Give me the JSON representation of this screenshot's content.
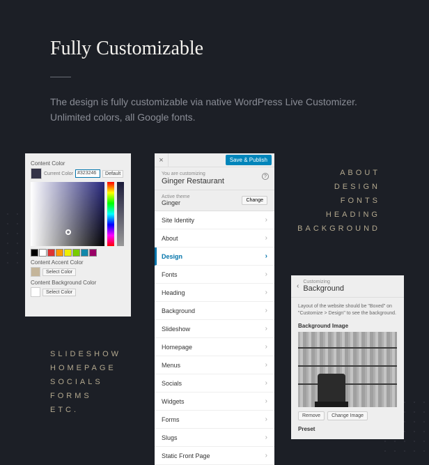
{
  "hero": {
    "title": "Fully Customizable",
    "description": "The design is fully customizable via native WordPress Live Customizer. Unlimited colors, all Google fonts."
  },
  "left_list": [
    "SLIDESHOW",
    "HOMEPAGE",
    "SOCIALS",
    "FORMS",
    "ETC."
  ],
  "right_list": [
    "ABOUT",
    "DESIGN",
    "FONTS",
    "HEADING",
    "BACKGROUND"
  ],
  "panel1": {
    "content_color_label": "Content Color",
    "current_color_label": "Current Color",
    "hex": "#323246",
    "default_btn": "Default",
    "swatch_row": [
      "#000000",
      "#ffffff",
      "#d33",
      "#f90",
      "#ee0",
      "#7c0",
      "#18a",
      "#906"
    ],
    "accent_label": "Content Accent Color",
    "accent_swatch": "#c4b59a",
    "select_color_btn": "Select Color",
    "bg_label": "Content Background Color",
    "bg_swatch": "#ffffff"
  },
  "panel2": {
    "save_btn": "Save & Publish",
    "you_are": "You are customizing",
    "site_title": "Ginger Restaurant",
    "active_theme_label": "Active theme",
    "active_theme_name": "Ginger",
    "change_btn": "Change",
    "items": [
      {
        "label": "Site Identity",
        "active": false
      },
      {
        "label": "About",
        "active": false
      },
      {
        "label": "Design",
        "active": true
      },
      {
        "label": "Fonts",
        "active": false
      },
      {
        "label": "Heading",
        "active": false
      },
      {
        "label": "Background",
        "active": false
      },
      {
        "label": "Slideshow",
        "active": false
      },
      {
        "label": "Homepage",
        "active": false
      },
      {
        "label": "Menus",
        "active": false
      },
      {
        "label": "Socials",
        "active": false
      },
      {
        "label": "Widgets",
        "active": false
      },
      {
        "label": "Forms",
        "active": false
      },
      {
        "label": "Slugs",
        "active": false
      },
      {
        "label": "Static Front Page",
        "active": false
      }
    ]
  },
  "panel3": {
    "customizing_label": "Customizing",
    "section_title": "Background",
    "note": "Layout of the website should be \"Boxed\" on \"Customize > Design\" to see the background.",
    "bg_image_label": "Background Image",
    "remove_btn": "Remove",
    "change_img_btn": "Change Image",
    "preset_label": "Preset"
  }
}
